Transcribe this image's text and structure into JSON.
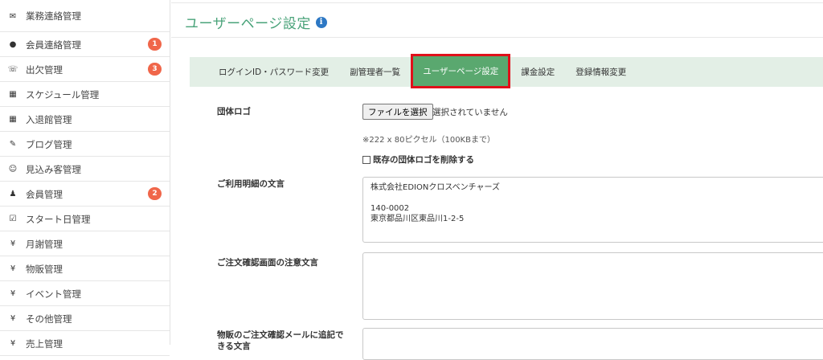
{
  "sidebar": {
    "items": [
      {
        "icon": "envelope-icon",
        "glyph": "✉",
        "label": "業務連絡管理",
        "badge": ""
      },
      {
        "icon": "comment-icon",
        "glyph": "●",
        "label": "会員連絡管理",
        "badge": "1"
      },
      {
        "icon": "phone-icon",
        "glyph": "☏",
        "label": "出欠管理",
        "badge": "3"
      },
      {
        "icon": "calendar-icon",
        "glyph": "▦",
        "label": "スケジュール管理",
        "badge": ""
      },
      {
        "icon": "calendar-icon",
        "glyph": "▦",
        "label": "入退館管理",
        "badge": ""
      },
      {
        "icon": "pencil-icon",
        "glyph": "✎",
        "label": "ブログ管理",
        "badge": ""
      },
      {
        "icon": "smile-icon",
        "glyph": "☺",
        "label": "見込み客管理",
        "badge": ""
      },
      {
        "icon": "user-icon",
        "glyph": "♟",
        "label": "会員管理",
        "badge": "2"
      },
      {
        "icon": "check-square-icon",
        "glyph": "☑",
        "label": "スタート日管理",
        "badge": ""
      },
      {
        "icon": "yen-icon",
        "glyph": "¥",
        "label": "月謝管理",
        "badge": ""
      },
      {
        "icon": "yen-icon",
        "glyph": "¥",
        "label": "物販管理",
        "badge": ""
      },
      {
        "icon": "yen-icon",
        "glyph": "¥",
        "label": "イベント管理",
        "badge": ""
      },
      {
        "icon": "yen-icon",
        "glyph": "¥",
        "label": "その他管理",
        "badge": ""
      },
      {
        "icon": "yen-icon",
        "glyph": "¥",
        "label": "売上管理",
        "badge": ""
      }
    ]
  },
  "header": {
    "title": "ユーザーページ設定",
    "info_glyph": "i"
  },
  "tabs": [
    {
      "label": "ログインID・パスワード変更",
      "active": false
    },
    {
      "label": "副管理者一覧",
      "active": false
    },
    {
      "label": "ユーザーページ設定",
      "active": true
    },
    {
      "label": "課金設定",
      "active": false
    },
    {
      "label": "登録情報変更",
      "active": false
    }
  ],
  "form": {
    "logo_label": "団体ロゴ",
    "file_button": "ファイルを選択",
    "file_status": "選択されていません",
    "size_hint": "※222 x 80ピクセル（100KBまで）",
    "delete_logo_label": "既存の団体ロゴを削除する",
    "statement_label": "ご利用明細の文言",
    "statement_lines": [
      "株式会社EDIONクロスベンチャーズ",
      "",
      "140-0002",
      "東京都品川区東品川1-2-5"
    ],
    "order_notice_label": "ご注文確認画面の注意文言",
    "order_notice_value": "",
    "mail_label_line1": "物販のご注文確認メールに追記で",
    "mail_label_line2": "きる文言"
  },
  "colors": {
    "accent": "#4aa37a",
    "active_tab": "#5aa86f",
    "highlight": "#e0101a",
    "badge": "#f0664a",
    "tabbar": "#e3efe6"
  }
}
